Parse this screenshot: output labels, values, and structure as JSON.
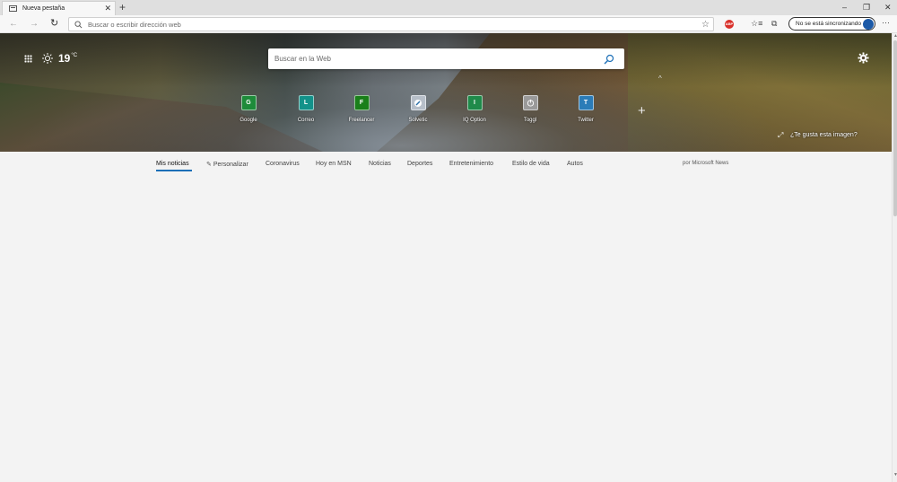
{
  "tab": {
    "title": "Nueva pestaña",
    "close": "✕"
  },
  "newtab_label": "+",
  "window": {
    "minimize": "–",
    "restore": "❐",
    "close": "✕"
  },
  "toolbar": {
    "back": "←",
    "forward": "→",
    "refresh": "↻",
    "address_placeholder": "Buscar o escribir dirección web",
    "favorite": "☆",
    "adblock": "ABP",
    "favorites": "☆≡",
    "collections": "⧉",
    "sync_label": "No se está sincronizando",
    "more": "···"
  },
  "hero": {
    "temperature": "19",
    "unit": "°C",
    "search_placeholder": "Buscar en la Web",
    "collapse": "^",
    "add_tile": "+",
    "expand": "⤢",
    "image_prompt": "¿Te gusta esta imagen?",
    "tiles": [
      {
        "label": "Google",
        "letter": "G",
        "color": "#1e8b3a"
      },
      {
        "label": "Correo",
        "letter": "L",
        "color": "#13928a"
      },
      {
        "label": "Freelancer",
        "letter": "F",
        "color": "#1a7f1a"
      },
      {
        "label": "Solvetic",
        "letter": "",
        "color": "#b7bfc9"
      },
      {
        "label": "IQ Option",
        "letter": "I",
        "color": "#1f8a4a"
      },
      {
        "label": "Toggl",
        "letter": "",
        "color": "#9a9a9a"
      },
      {
        "label": "Twitter",
        "letter": "T",
        "color": "#2b7cb8"
      }
    ]
  },
  "news_nav": {
    "items": [
      "Mis noticias",
      "Personalizar",
      "Coronavirus",
      "Hoy en MSN",
      "Noticias",
      "Deportes",
      "Entretenimiento",
      "Estilo de vida",
      "Autos"
    ],
    "source": "por Microsoft News",
    "pencil": "✎"
  },
  "scroll": {
    "up": "▲",
    "down": "▼"
  }
}
